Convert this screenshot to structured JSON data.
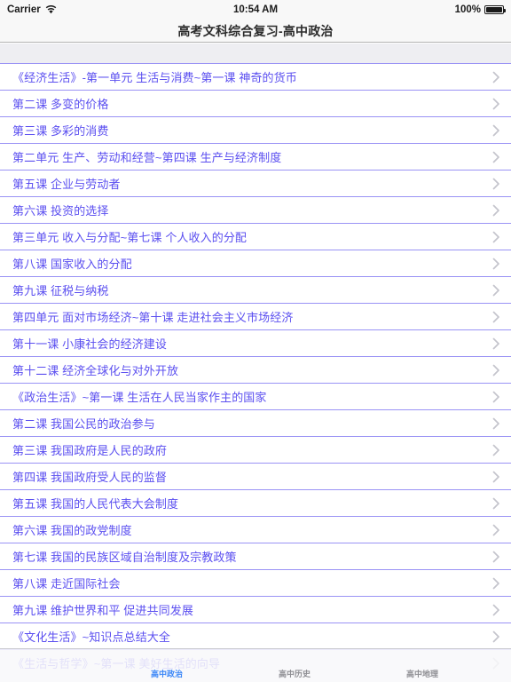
{
  "status_bar": {
    "carrier": "Carrier",
    "wifi_icon": "wifi-icon",
    "time": "10:54 AM",
    "battery_percent": "100%",
    "battery_icon": "battery-full-icon"
  },
  "nav_bar": {
    "title": "高考文科综合复习-高中政治"
  },
  "theme": {
    "row_text_color": "#5b4ff0",
    "separator_color": "#9a93f5",
    "tab_selected_color": "#3a86f7",
    "tab_inactive_color": "#8e8e93",
    "nav_background": "#f8f8f8",
    "list_header_background": "#eeeef2"
  },
  "list": {
    "disclosure_icon": "chevron-right-icon",
    "rows": [
      {
        "label": "《经济生活》-第一单元 生活与消费~第一课 神奇的货币"
      },
      {
        "label": "第二课 多变的价格"
      },
      {
        "label": "第三课 多彩的消费"
      },
      {
        "label": "第二单元 生产、劳动和经营~第四课 生产与经济制度"
      },
      {
        "label": "第五课 企业与劳动者"
      },
      {
        "label": "第六课 投资的选择"
      },
      {
        "label": "第三单元 收入与分配~第七课 个人收入的分配"
      },
      {
        "label": "第八课 国家收入的分配"
      },
      {
        "label": "第九课 征税与纳税"
      },
      {
        "label": "第四单元 面对市场经济~第十课 走进社会主义市场经济"
      },
      {
        "label": "第十一课 小康社会的经济建设"
      },
      {
        "label": "第十二课 经济全球化与对外开放"
      },
      {
        "label": "《政治生活》~第一课 生活在人民当家作主的国家"
      },
      {
        "label": "第二课 我国公民的政治参与"
      },
      {
        "label": "第三课 我国政府是人民的政府"
      },
      {
        "label": "第四课 我国政府受人民的监督"
      },
      {
        "label": "第五课 我国的人民代表大会制度"
      },
      {
        "label": "第六课 我国的政党制度"
      },
      {
        "label": "第七课 我国的民族区域自治制度及宗教政策"
      },
      {
        "label": "第八课 走近国际社会"
      },
      {
        "label": "第九课 维护世界和平 促进共同发展"
      },
      {
        "label": "《文化生活》~知识点总结大全"
      },
      {
        "label": "《生活与哲学》~第一课 美好生活的向导"
      }
    ]
  },
  "tab_bar": {
    "tabs": [
      {
        "label": "高中政治",
        "selected": true
      },
      {
        "label": "高中历史",
        "selected": false
      },
      {
        "label": "高中地理",
        "selected": false
      }
    ]
  }
}
